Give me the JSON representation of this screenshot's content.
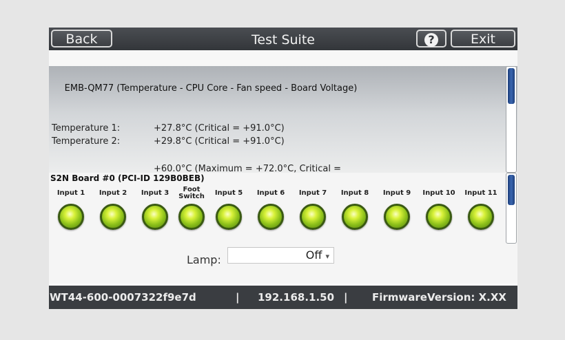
{
  "titlebar": {
    "back_label": "Back",
    "title": "Test Suite",
    "help_label": "?",
    "exit_label": "Exit"
  },
  "sensor": {
    "chip_title": "EMB-QM77 (Temperature - CPU Core - Fan speed - Board Voltage)",
    "rows": [
      {
        "label": "Temperature 1:",
        "value": "+27.8°C (Critical = +91.0°C)"
      },
      {
        "label": "Temperature 2:",
        "value": "+29.8°C (Critical = +91.0°C)"
      },
      {
        "label": "",
        "value": "+60.0°C (Maximum = +72.0°C, Critical ="
      }
    ]
  },
  "board": {
    "title": "S2N Board #0 (PCI-ID 129B0BEB)",
    "inputs": [
      "Input 1",
      "Input 2",
      "Input 3",
      "Foot Switch",
      "Input 5",
      "Input 6",
      "Input 7",
      "Input 8",
      "Input 9",
      "Input 10",
      "Input 11"
    ],
    "led_color": "#9acd1f",
    "lamp": {
      "label": "Lamp:",
      "value": "Off"
    }
  },
  "status": {
    "device_id": "WT44-600-0007322f9e7d",
    "separator": "|",
    "ip": "192.168.1.50",
    "firmware": "FirmwareVersion: X.XX"
  },
  "colors": {
    "titlebar": "#3a3d41",
    "scrollbar_thumb": "#2c5597"
  }
}
